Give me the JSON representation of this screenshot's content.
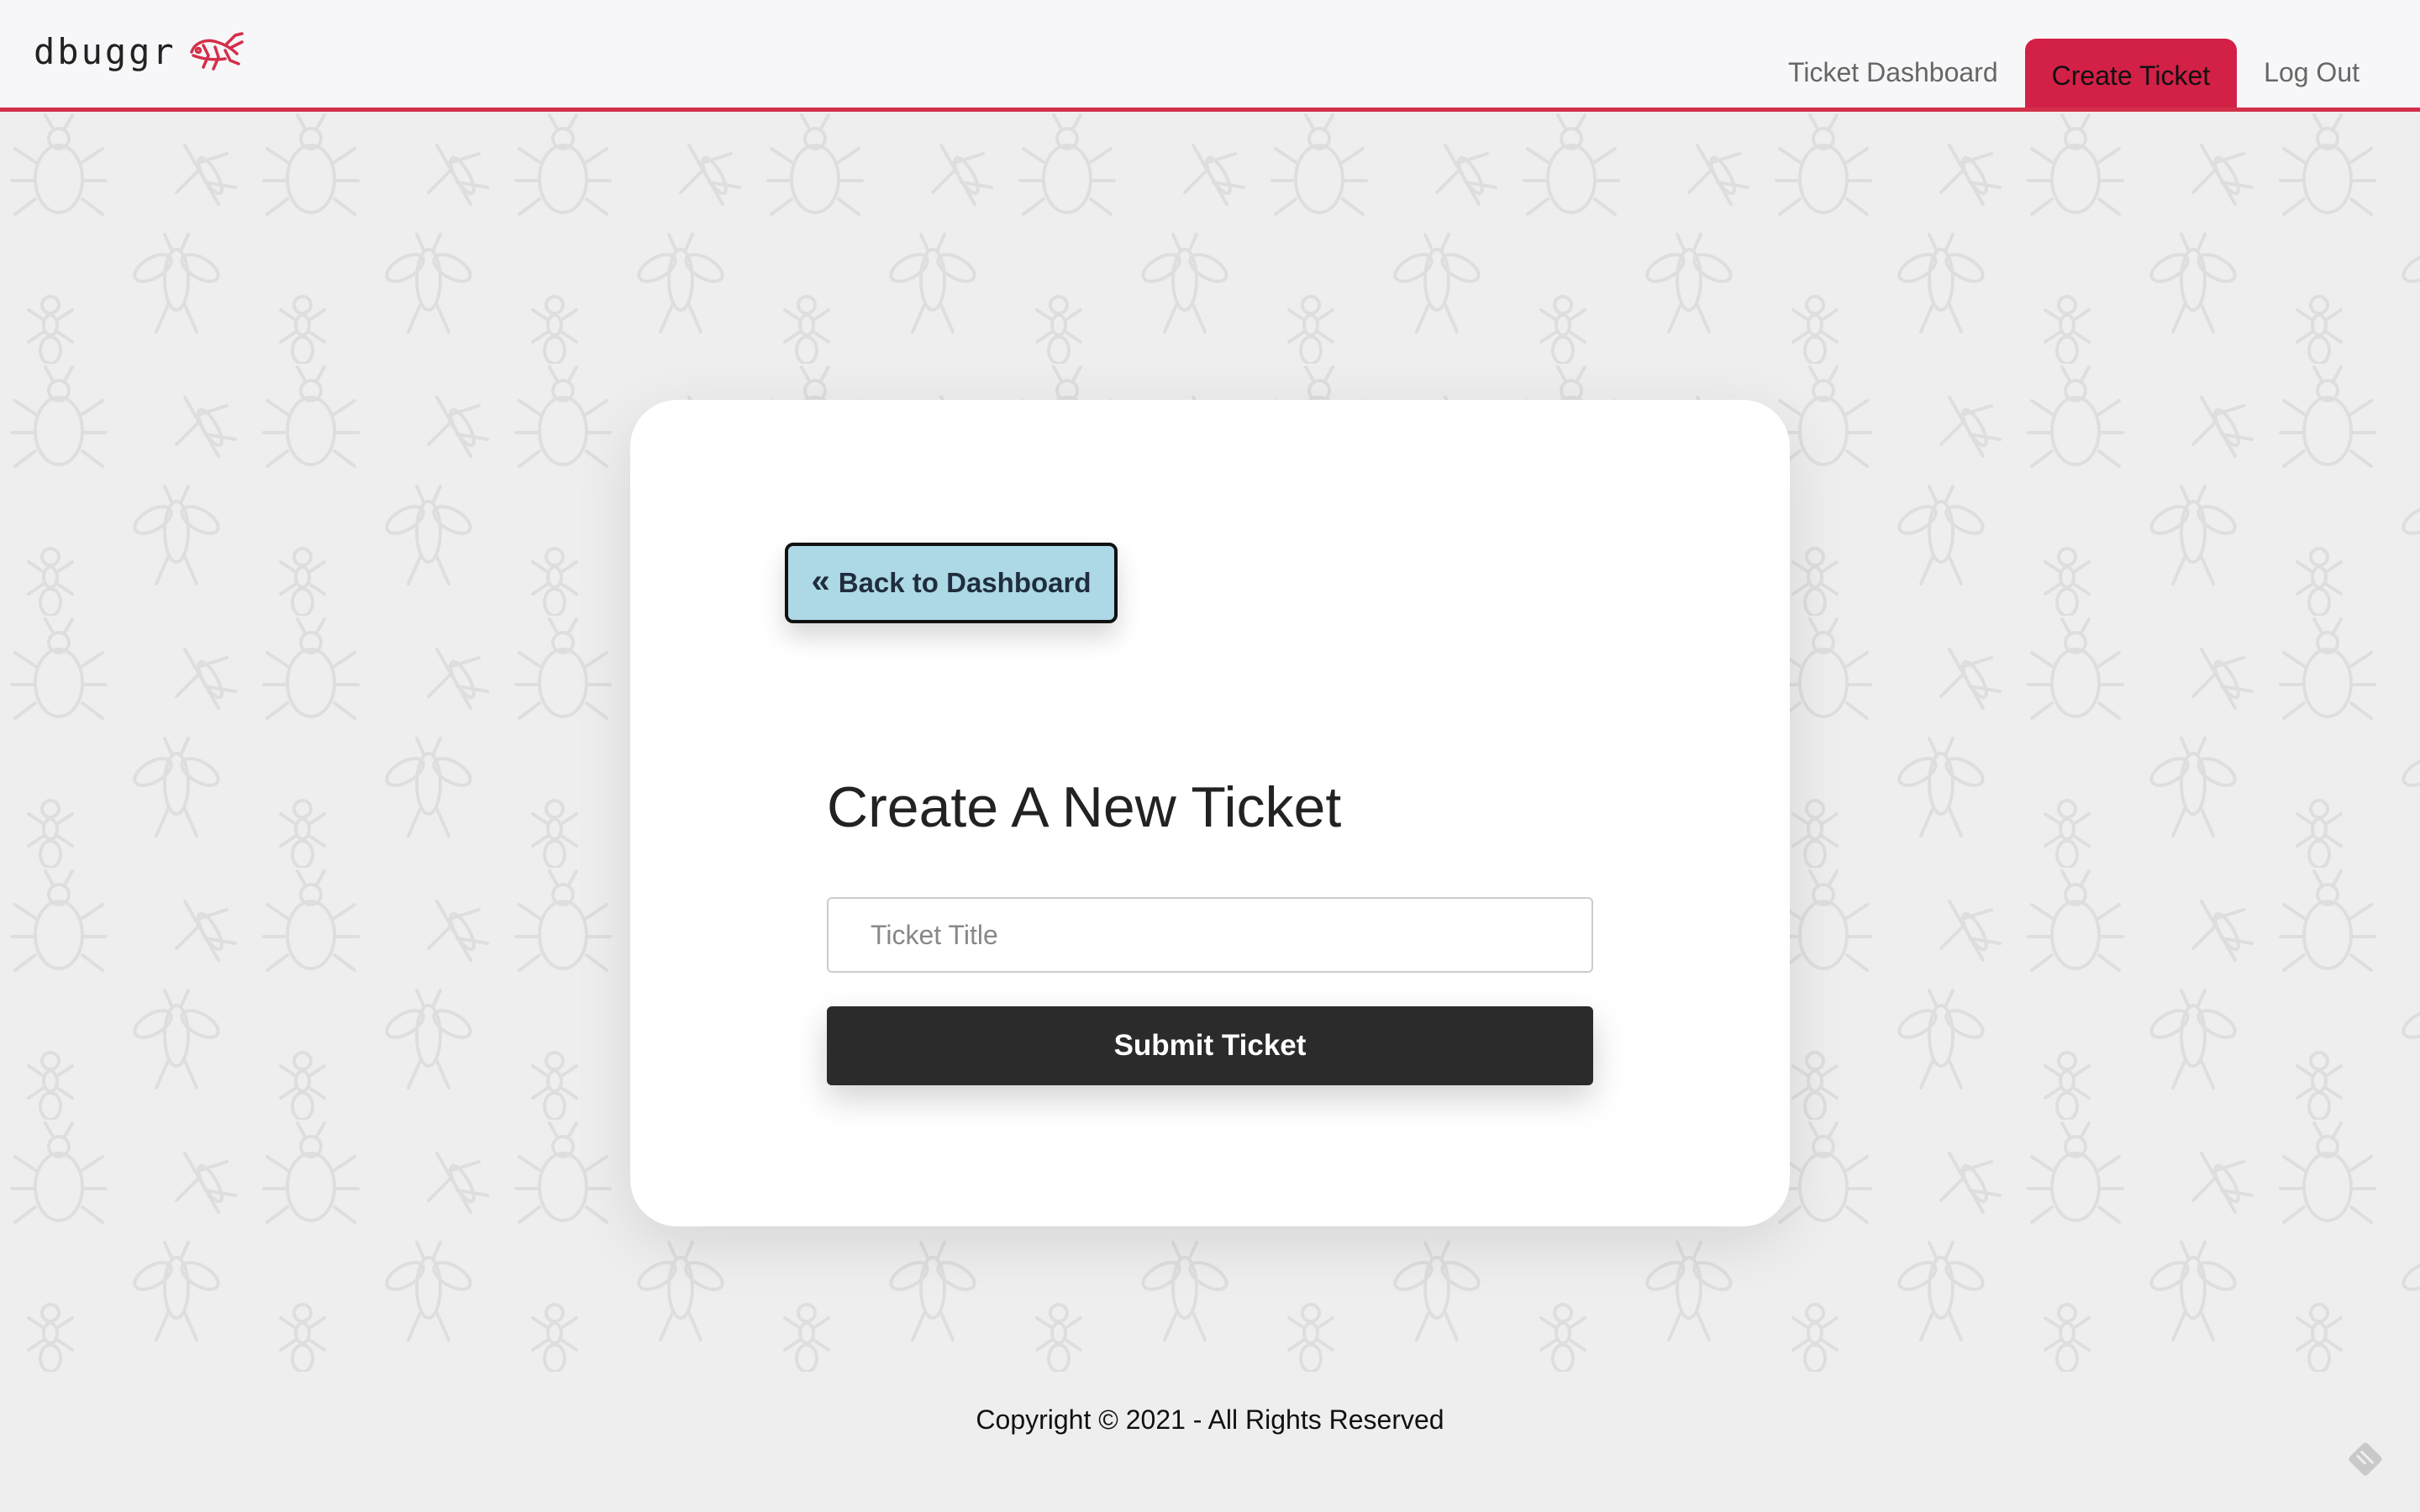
{
  "brand": {
    "name": "dbuggr",
    "logo_icon": "grasshopper-icon",
    "accent_color": "#d32047"
  },
  "nav": {
    "items": [
      {
        "label": "Ticket Dashboard",
        "active": false
      },
      {
        "label": "Create Ticket",
        "active": true
      },
      {
        "label": "Log Out",
        "active": false
      }
    ]
  },
  "card": {
    "back_button": {
      "label": "Back to Dashboard",
      "icon": "double-chevron-left-icon",
      "color": "#add8e6"
    },
    "title": "Create A New Ticket",
    "ticket_title_input": {
      "value": "",
      "placeholder": "Ticket Title"
    },
    "submit_button": {
      "label": "Submit Ticket"
    }
  },
  "footer": {
    "copyright": "Copyright © 2021 - All Rights Reserved",
    "corner_icon": "sticky-note-icon"
  }
}
